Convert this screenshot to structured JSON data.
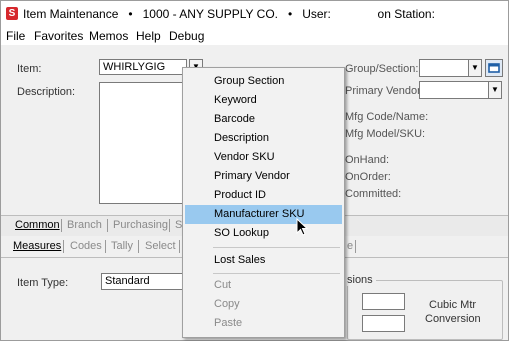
{
  "window": {
    "title": "Item Maintenance   •   1000 - ANY SUPPLY CO.   •   User:              on Station:"
  },
  "menubar": {
    "items": [
      "File",
      "Favorites",
      "Memos",
      "Help",
      "Debug"
    ]
  },
  "form": {
    "item_label": "Item:",
    "item_value": "WHIRLYGIG",
    "description_label": "Description:",
    "group_section_label": "Group/Section:",
    "primary_vendor_label": "Primary Vendor:",
    "mfg_code_label": "Mfg Code/Name:",
    "mfg_model_label": "Mfg Model/SKU:",
    "onhand_label": "OnHand:",
    "onorder_label": "OnOrder:",
    "committed_label": "Committed:"
  },
  "tabs_row1": [
    "Common",
    "Branch",
    "Purchasing",
    "S"
  ],
  "tabs_row2": [
    "Measures",
    "Codes",
    "Tally",
    "Select",
    "e"
  ],
  "lower": {
    "item_type_label": "Item Type:",
    "item_type_value": "Standard",
    "group_title": "sions",
    "cubic_label_line1": "Cubic Mtr",
    "cubic_label_line2": "Conversion"
  },
  "context_menu": {
    "items": [
      {
        "label": "Group Section",
        "state": "normal"
      },
      {
        "label": "Keyword",
        "state": "normal"
      },
      {
        "label": "Barcode",
        "state": "normal"
      },
      {
        "label": "Description",
        "state": "normal"
      },
      {
        "label": "Vendor SKU",
        "state": "normal"
      },
      {
        "label": "Primary Vendor",
        "state": "normal"
      },
      {
        "label": "Product ID",
        "state": "normal"
      },
      {
        "label": "Manufacturer SKU",
        "state": "highlighted"
      },
      {
        "label": "SO Lookup",
        "state": "normal"
      },
      {
        "label": "Lost Sales",
        "state": "normal"
      },
      {
        "label": "Cut",
        "state": "disabled"
      },
      {
        "label": "Copy",
        "state": "disabled"
      },
      {
        "label": "Paste",
        "state": "disabled"
      }
    ],
    "highlight_color": "#99c9ef"
  },
  "icons": {
    "app": "s-app-icon",
    "dropdown": "chevron-down-icon",
    "lookup": "lookup-window-icon",
    "cursor": "mouse-pointer-icon"
  },
  "colors": {
    "app_icon_red": "#d6282d",
    "lookup_blue": "#1f5fa6"
  }
}
